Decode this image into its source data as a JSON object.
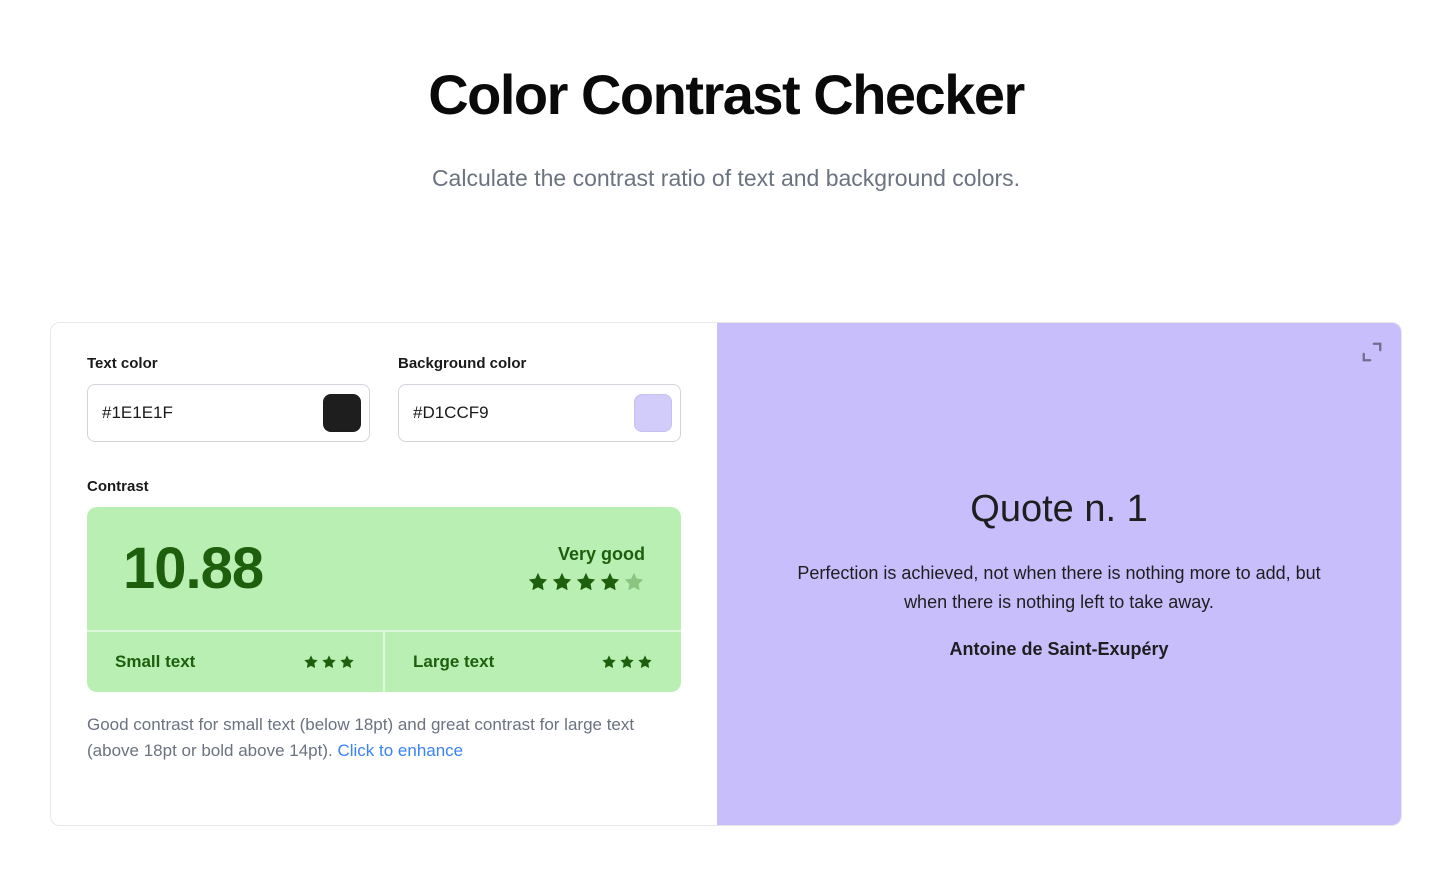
{
  "header": {
    "title": "Color Contrast Checker",
    "subtitle": "Calculate the contrast ratio of text and background colors."
  },
  "inputs": {
    "text_color": {
      "label": "Text color",
      "value": "#1E1E1F",
      "swatch": "#1E1E1F"
    },
    "background_color": {
      "label": "Background color",
      "value": "#D1CCF9",
      "swatch": "#D1CCF9"
    }
  },
  "contrast": {
    "label": "Contrast",
    "ratio": "10.88",
    "rating_text": "Very good",
    "main_stars": 4,
    "main_stars_total": 5,
    "box_bg": "#b9efb2",
    "ink": "#1e5f0d",
    "small_text": {
      "label": "Small text",
      "stars": 3,
      "stars_total": 3
    },
    "large_text": {
      "label": "Large text",
      "stars": 3,
      "stars_total": 3
    },
    "description": "Good contrast for small text (below 18pt) and great contrast for large text (above 18pt or bold above 14pt). ",
    "enhance_link": "Click to enhance"
  },
  "preview": {
    "bg": "#C8BEFB",
    "fg": "#1E1E1F",
    "quote_title": "Quote n. 1",
    "quote_text": "Perfection is achieved, not when there is nothing more to add, but when there is nothing left to take away.",
    "quote_author": "Antoine de Saint-Exupéry"
  }
}
